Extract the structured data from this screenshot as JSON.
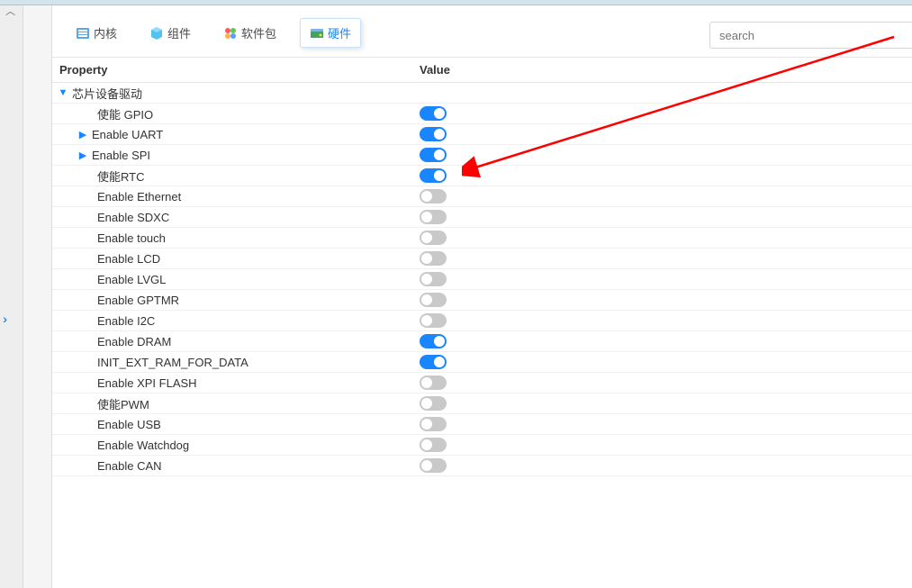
{
  "search": {
    "placeholder": "search"
  },
  "nav_tabs": [
    {
      "label": "内核"
    },
    {
      "label": "组件"
    },
    {
      "label": "软件包"
    },
    {
      "label": "硬件"
    }
  ],
  "grid_headers": {
    "property": "Property",
    "value": "Value"
  },
  "group": {
    "label": "芯片设备驱动"
  },
  "rows": [
    {
      "label": "使能 GPIO",
      "on": true,
      "expandable": false
    },
    {
      "label": "Enable UART",
      "on": true,
      "expandable": true
    },
    {
      "label": "Enable SPI",
      "on": true,
      "expandable": true
    },
    {
      "label": "使能RTC",
      "on": true,
      "expandable": false
    },
    {
      "label": "Enable Ethernet",
      "on": false,
      "expandable": false
    },
    {
      "label": "Enable SDXC",
      "on": false,
      "expandable": false
    },
    {
      "label": "Enable touch",
      "on": false,
      "expandable": false
    },
    {
      "label": "Enable LCD",
      "on": false,
      "expandable": false
    },
    {
      "label": "Enable LVGL",
      "on": false,
      "expandable": false
    },
    {
      "label": "Enable GPTMR",
      "on": false,
      "expandable": false
    },
    {
      "label": "Enable I2C",
      "on": false,
      "expandable": false
    },
    {
      "label": "Enable DRAM",
      "on": true,
      "expandable": false
    },
    {
      "label": "INIT_EXT_RAM_FOR_DATA",
      "on": true,
      "expandable": false
    },
    {
      "label": "Enable XPI FLASH",
      "on": false,
      "expandable": false
    },
    {
      "label": "使能PWM",
      "on": false,
      "expandable": false
    },
    {
      "label": "Enable USB",
      "on": false,
      "expandable": false
    },
    {
      "label": "Enable Watchdog",
      "on": false,
      "expandable": false
    },
    {
      "label": "Enable CAN",
      "on": false,
      "expandable": false
    }
  ]
}
